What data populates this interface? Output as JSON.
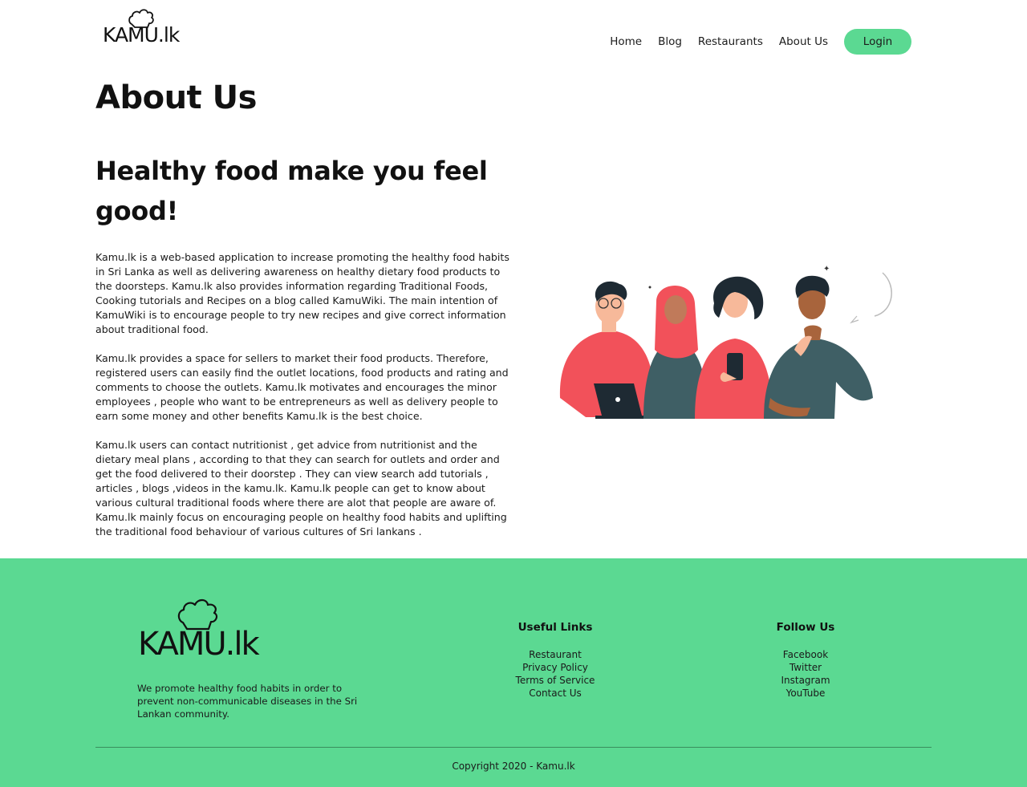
{
  "brand": {
    "logo_text": "KAMU.lk"
  },
  "nav": {
    "items": [
      {
        "label": "Home"
      },
      {
        "label": "Blog"
      },
      {
        "label": "Restaurants"
      },
      {
        "label": "About Us"
      }
    ],
    "login_label": "Login",
    "login_color": "#5bd992"
  },
  "main": {
    "title": "About Us",
    "headline": "Healthy food make you feel good!",
    "paragraphs": [
      "Kamu.lk is a web-based application to increase promoting the healthy food habits in Sri Lanka as well as delivering awareness on healthy dietary food products to the doorsteps. Kamu.lk also provides information regarding Traditional Foods, Cooking tutorials and Recipes on a blog called KamuWiki. The main intention of KamuWiki is to encourage people to try new recipes and give correct information about traditional food.",
      "Kamu.lk provides a space for sellers to market their food products. Therefore, registered users can easily find the outlet locations, food products and rating and comments to choose the outlets. Kamu.lk motivates and encourages the minor employees , people who want to be entrepreneurs as well as delivery people to earn some money and other benefits Kamu.lk is the best choice.",
      "Kamu.lk users can contact nutritionist , get advice from nutritionist and the dietary meal plans , according to that they can search for outlets and order and get the food delivered to their doorstep . They can view search add tutorials , articles , blogs ,videos in the kamu.lk. Kamu.lk people can get to know about various cultural traditional foods where there are alot that people are aware of. Kamu.lk mainly focus on encouraging people on healthy food habits and uplifting the traditional food behaviour of various cultures of Sri lankans ."
    ],
    "illustration_icon": "people-group-illustration"
  },
  "footer": {
    "background": "#5bd992",
    "logo_text": "KAMU.lk",
    "description": "We promote healthy food habits in order to prevent non-communicable diseases in the Sri Lankan community.",
    "useful_links": {
      "heading": "Useful Links",
      "items": [
        {
          "label": "Restaurant"
        },
        {
          "label": "Privacy Policy"
        },
        {
          "label": "Terms of Service"
        },
        {
          "label": "Contact Us"
        }
      ]
    },
    "follow_us": {
      "heading": "Follow Us",
      "items": [
        {
          "label": "Facebook"
        },
        {
          "label": "Twitter"
        },
        {
          "label": "Instagram"
        },
        {
          "label": "YouTube"
        }
      ]
    },
    "copyright": "Copyright 2020 - Kamu.lk"
  }
}
